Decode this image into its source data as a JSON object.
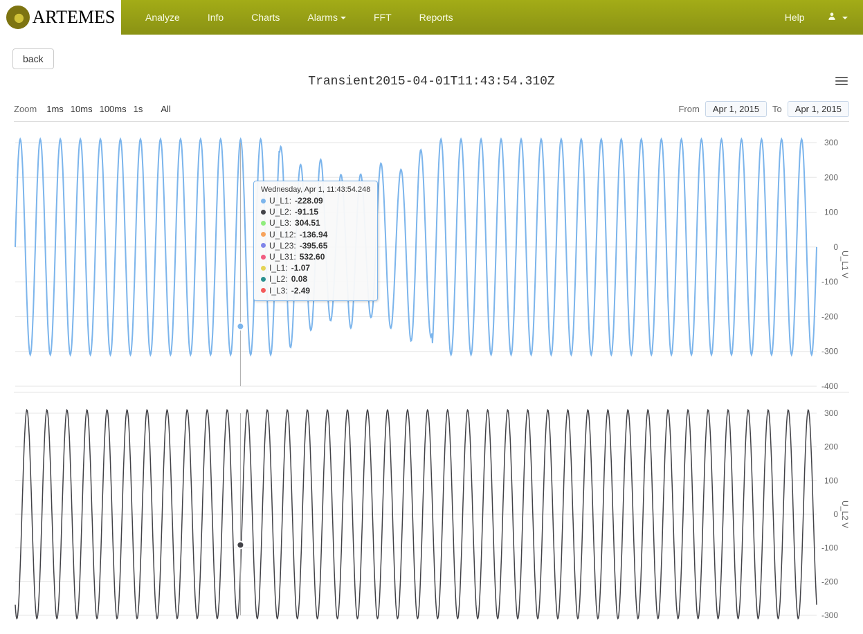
{
  "brand": "ARTEMES",
  "nav": {
    "items": [
      {
        "label": "Analyze"
      },
      {
        "label": "Info"
      },
      {
        "label": "Charts"
      },
      {
        "label": "Alarms",
        "has_caret": true
      },
      {
        "label": "FFT"
      },
      {
        "label": "Reports"
      }
    ],
    "help": "Help"
  },
  "back_label": "back",
  "chart_title": "Transient2015-04-01T11:43:54.310Z",
  "zoom": {
    "label": "Zoom",
    "options": [
      "1ms",
      "10ms",
      "100ms",
      "1s",
      "All"
    ]
  },
  "date_range": {
    "from_label": "From",
    "to_label": "To",
    "from_value": "Apr 1, 2015",
    "to_value": "Apr 1, 2015"
  },
  "tooltip": {
    "title": "Wednesday, Apr 1, 11:43:54.248",
    "rows": [
      {
        "name": "U_L1",
        "value": "-228.09",
        "color": "#7cb5ec"
      },
      {
        "name": "U_L2",
        "value": "-91.15",
        "color": "#434348"
      },
      {
        "name": "U_L3",
        "value": "304.51",
        "color": "#90ed7d"
      },
      {
        "name": "U_L12",
        "value": "-136.94",
        "color": "#f7a35c"
      },
      {
        "name": "U_L23",
        "value": "-395.65",
        "color": "#8085e9"
      },
      {
        "name": "U_L31",
        "value": "532.60",
        "color": "#f15c80"
      },
      {
        "name": "I_L1",
        "value": "-1.07",
        "color": "#e4d354"
      },
      {
        "name": "I_L2",
        "value": "0.08",
        "color": "#2b908f"
      },
      {
        "name": "I_L3",
        "value": "-2.49",
        "color": "#f45b5b"
      }
    ]
  },
  "chart_data": [
    {
      "type": "line",
      "series_name": "U_L1",
      "ylabel": "U_L1 V",
      "ylim": [
        -400,
        300
      ],
      "yticks": [
        300,
        200,
        100,
        0,
        -100,
        -200,
        -300,
        -400
      ],
      "amplitude_normal": 310,
      "amplitude_disturbed": 260,
      "cycles": 40,
      "color": "#7cb5ec",
      "disturbance_range_fraction": [
        0.33,
        0.52
      ],
      "hover_fraction": 0.281,
      "hover_value": -228.09
    },
    {
      "type": "line",
      "series_name": "U_L2",
      "ylabel": "U_L2 V",
      "ylim": [
        -300,
        300
      ],
      "yticks": [
        300,
        200,
        100,
        0,
        -100,
        -200,
        -300
      ],
      "amplitude_normal": 310,
      "cycles": 40,
      "color": "#434348",
      "hover_fraction": 0.281,
      "hover_value": -91.15
    }
  ]
}
